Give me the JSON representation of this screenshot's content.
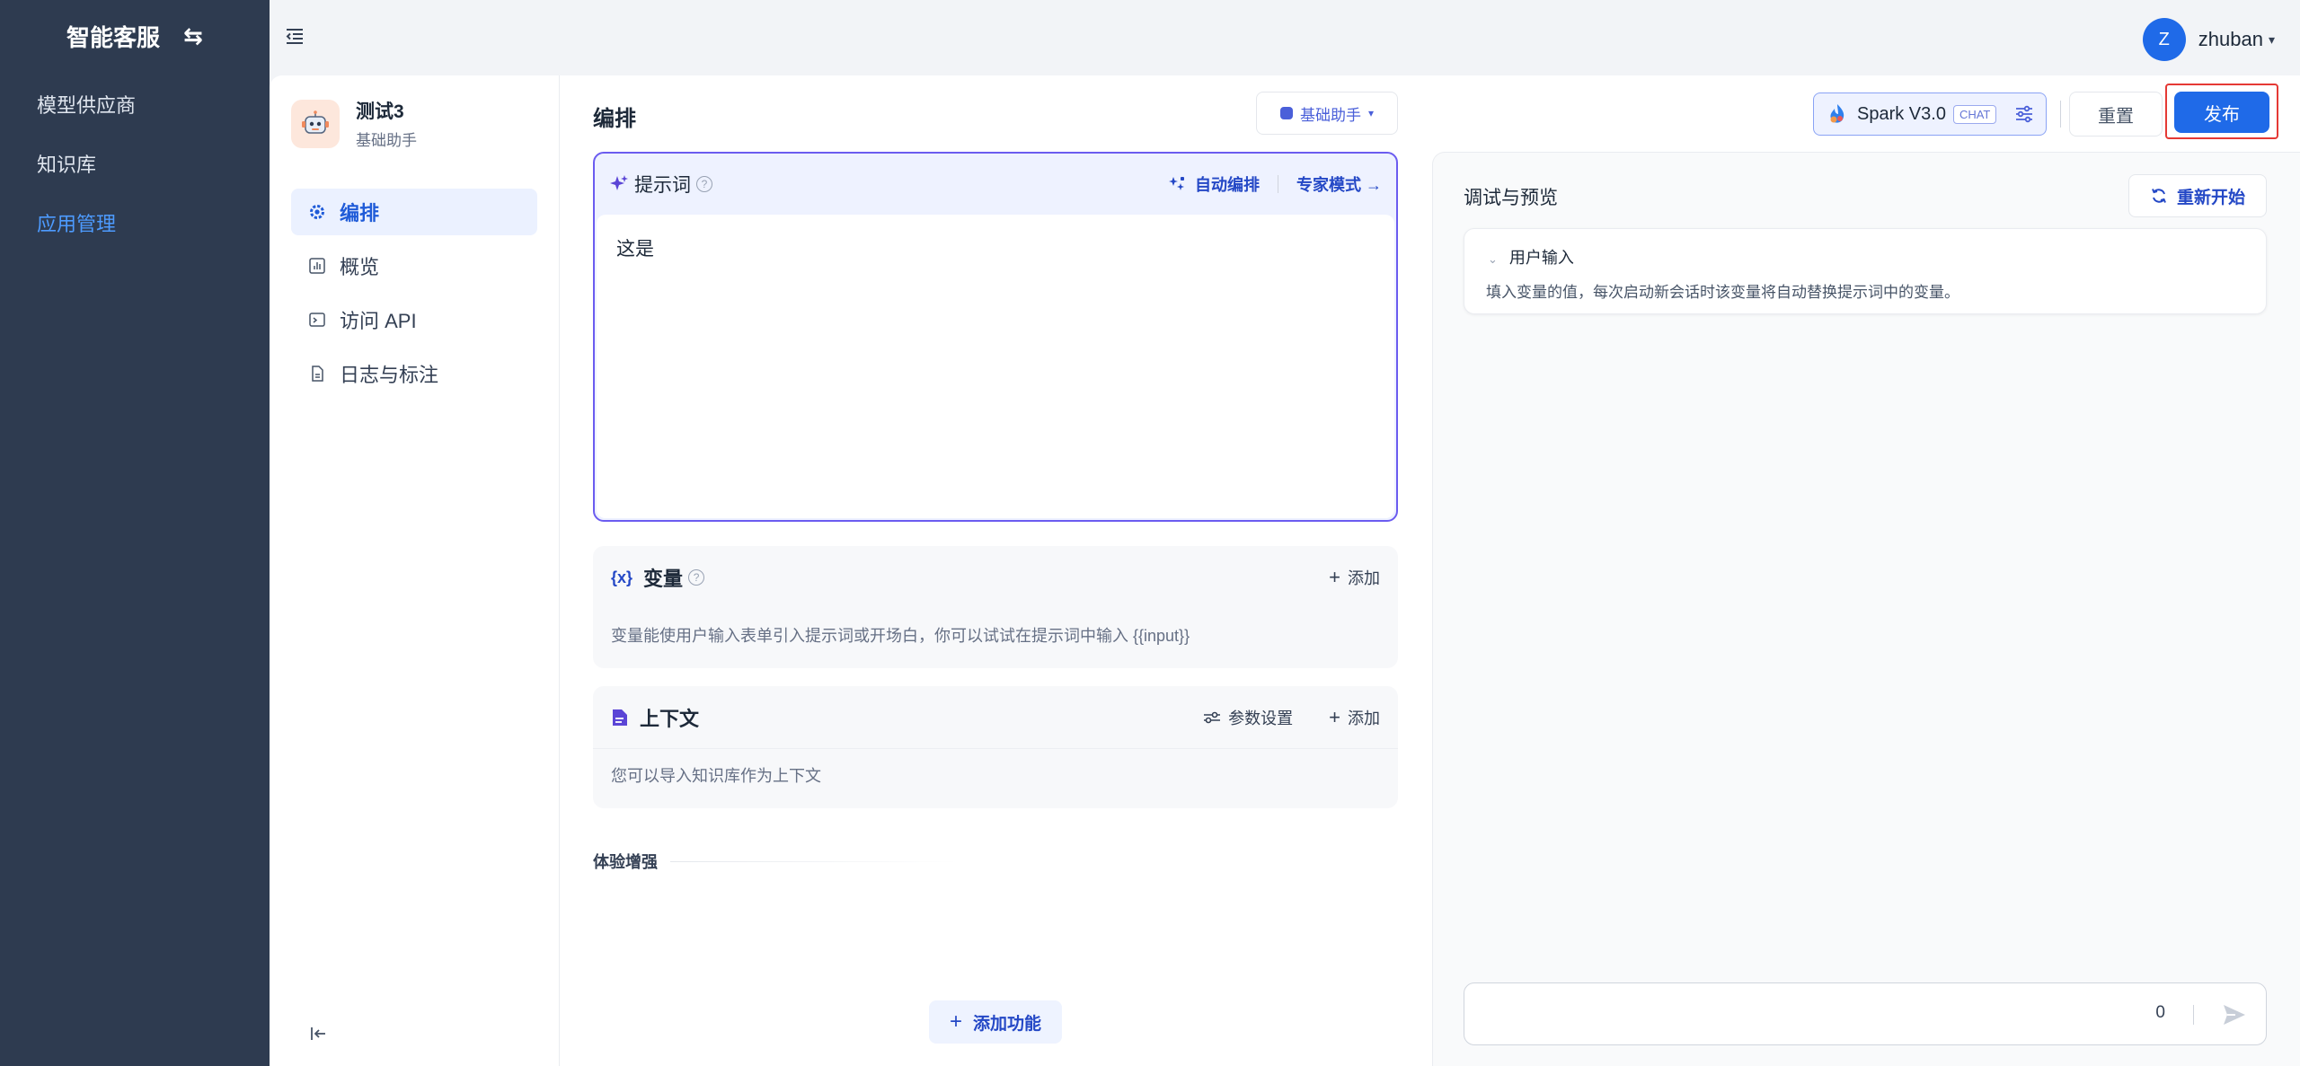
{
  "sidebar": {
    "brand": "智能客服",
    "swap_icon": "swap-arrows-icon",
    "items": [
      {
        "label": "模型供应商",
        "active": false
      },
      {
        "label": "知识库",
        "active": false
      },
      {
        "label": "应用管理",
        "active": true
      }
    ]
  },
  "topbar": {
    "avatar_initial": "Z",
    "username": "zhuban"
  },
  "app": {
    "name": "测试3",
    "type": "基础助手",
    "nav": [
      {
        "label": "编排",
        "icon": "gear-icon",
        "active": true
      },
      {
        "label": "概览",
        "icon": "chart-icon",
        "active": false
      },
      {
        "label": "访问 API",
        "icon": "terminal-icon",
        "active": false
      },
      {
        "label": "日志与标注",
        "icon": "document-icon",
        "active": false
      }
    ]
  },
  "editor": {
    "title": "编排",
    "mode_label": "基础助手",
    "prompt": {
      "label": "提示词",
      "auto_label": "自动编排",
      "expert_label": "专家模式 →",
      "content": "这是"
    },
    "variables": {
      "title": "变量",
      "add_label": "添加",
      "desc": "变量能使用户输入表单引入提示词或开场白，你可以试试在提示词中输入 {{input}}"
    },
    "context": {
      "title": "上下文",
      "params_label": "参数设置",
      "add_label": "添加",
      "desc": "您可以导入知识库作为上下文"
    },
    "enhance_label": "体验增强",
    "add_feature_label": "添加功能"
  },
  "header_actions": {
    "model_name": "Spark V3.0",
    "model_badge": "CHAT",
    "reset_label": "重置",
    "publish_label": "发布"
  },
  "debug": {
    "title": "调试与预览",
    "restart_label": "重新开始",
    "user_input_title": "用户输入",
    "user_input_desc": "填入变量的值，每次启动新会话时该变量将自动替换提示词中的变量。",
    "char_count": "0"
  },
  "colors": {
    "sidebar_bg": "#2e3b50",
    "accent": "#1f6ae8",
    "prompt_border": "#6b5cf0",
    "highlight": "#e53935"
  }
}
